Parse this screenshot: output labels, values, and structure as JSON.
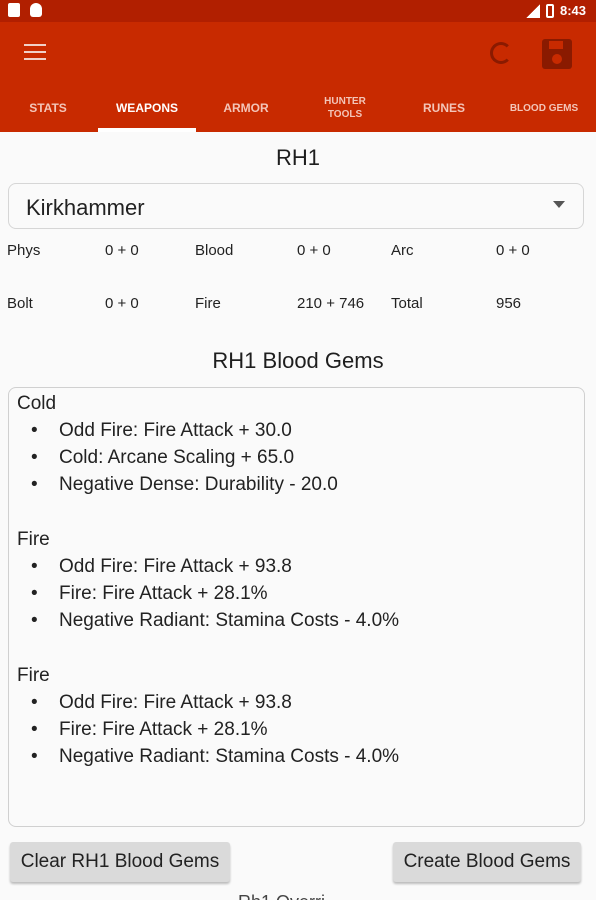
{
  "status_bar": {
    "time": "8:43",
    "icons": [
      "notification-icon",
      "android-icon",
      "signal-icon",
      "battery-icon"
    ]
  },
  "app_bar": {
    "color": "#c82a00",
    "status_color": "#b11f00",
    "icons": [
      "menu-icon",
      "refresh-icon",
      "save-icon"
    ]
  },
  "tabs": [
    {
      "label": "STATS",
      "active": false
    },
    {
      "label": "WEAPONS",
      "active": true
    },
    {
      "label": "ARMOR",
      "active": false
    },
    {
      "label": "HUNTER\nTOOLS",
      "active": false
    },
    {
      "label": "RUNES",
      "active": false
    },
    {
      "label": "BLOOD GEMS",
      "active": false
    }
  ],
  "weapon": {
    "slot_title": "RH1",
    "selected": "Kirkhammer",
    "stats": [
      {
        "label": "Phys",
        "value": "0 + 0"
      },
      {
        "label": "Blood",
        "value": "0 + 0"
      },
      {
        "label": "Arc",
        "value": "0 + 0"
      },
      {
        "label": "Bolt",
        "value": "0 + 0"
      },
      {
        "label": "Fire",
        "value": "210 + 746"
      },
      {
        "label": "Total",
        "value": "956"
      }
    ]
  },
  "blood_gems": {
    "title": "RH1 Blood Gems",
    "groups": [
      {
        "name": "Cold",
        "lines": [
          "Odd Fire: Fire Attack + 30.0",
          "Cold: Arcane Scaling + 65.0",
          "Negative Dense: Durability - 20.0"
        ]
      },
      {
        "name": "Fire",
        "lines": [
          "Odd Fire: Fire Attack + 93.8",
          "Fire: Fire Attack + 28.1%",
          "Negative Radiant: Stamina Costs - 4.0%"
        ]
      },
      {
        "name": "Fire",
        "lines": [
          "Odd Fire: Fire Attack + 93.8",
          "Fire: Fire Attack + 28.1%",
          "Negative Radiant: Stamina Costs - 4.0%"
        ]
      }
    ],
    "bullet": "•",
    "clear_button": "Clear RH1 Blood Gems",
    "create_button": "Create Blood Gems"
  },
  "peek_text": "Rh1 Overri..."
}
